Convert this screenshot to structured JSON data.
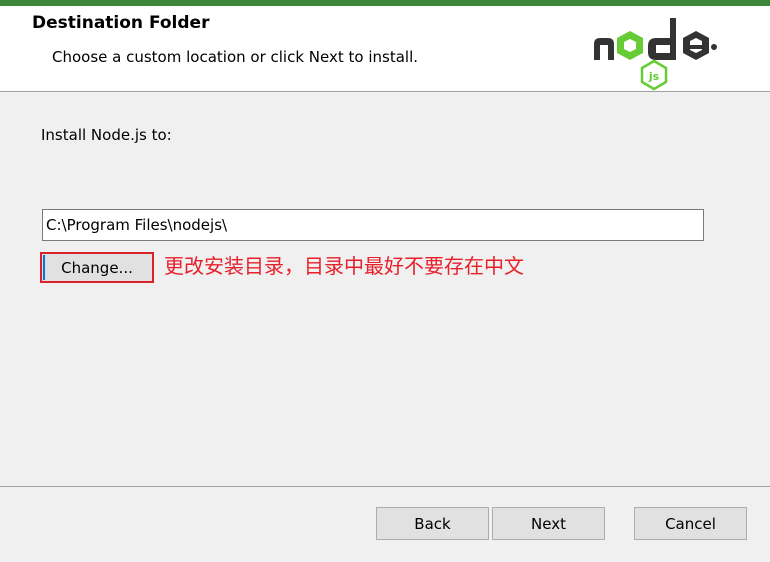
{
  "header": {
    "title": "Destination Folder",
    "subtitle": "Choose a custom location or click Next to install."
  },
  "logo": {
    "word": "node",
    "badge": "JS"
  },
  "body": {
    "install_label": "Install Node.js to:",
    "path_value": "C:\\Program Files\\nodejs\\",
    "change_label": "Change...",
    "annotation": "更改安装目录，目录中最好不要存在中文"
  },
  "footer": {
    "back_label": "Back",
    "next_label": "Next",
    "cancel_label": "Cancel"
  },
  "colors": {
    "accent_green": "#3c873a",
    "logo_dark": "#333333",
    "logo_green": "#66cc33",
    "annotation_red": "#e8202a"
  }
}
